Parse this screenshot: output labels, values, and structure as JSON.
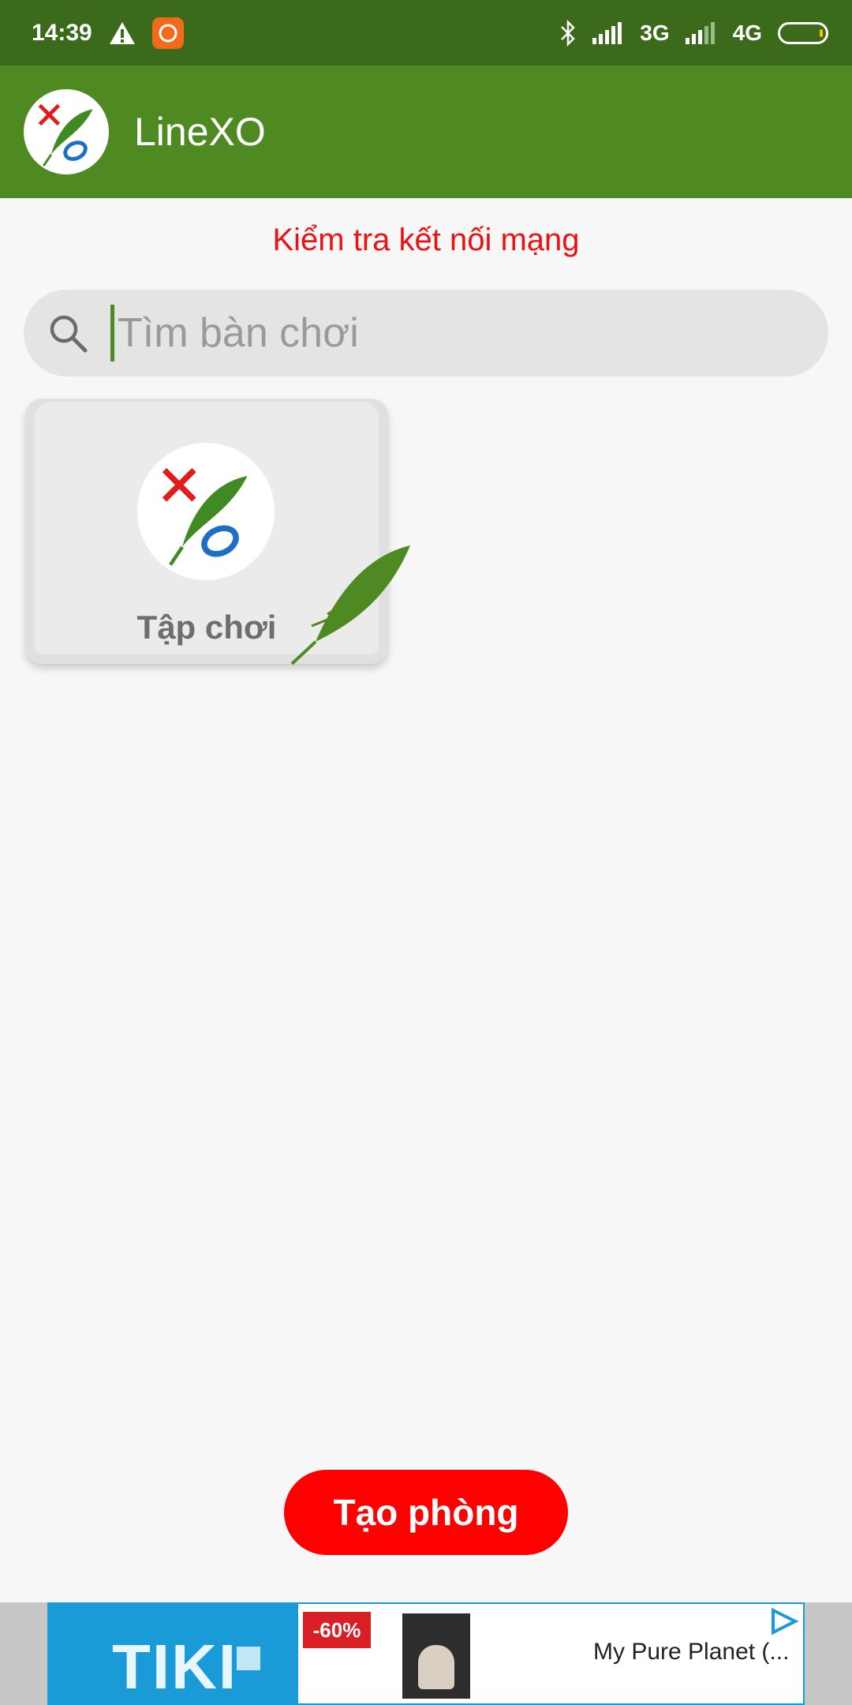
{
  "status_bar": {
    "time": "14:39",
    "network_3g": "3G",
    "network_4g": "4G",
    "icons": [
      "warning-icon",
      "mi-icon",
      "bluetooth-icon",
      "signal-icon",
      "battery-icon"
    ]
  },
  "app_bar": {
    "title": "LineXO",
    "logo_icon": "xo-feather-logo"
  },
  "main": {
    "network_message": "Kiểm tra kết nối mạng",
    "search": {
      "placeholder": "Tìm bàn chơi",
      "value": ""
    },
    "rooms": [
      {
        "label": "Tập chơi",
        "icon": "xo-feather-logo"
      }
    ],
    "create_button": "Tạo phòng"
  },
  "ad": {
    "brand": "TIKI",
    "discount": "-60%",
    "text": "My Pure Planet (...",
    "colors": {
      "brand": "#1a9bd7",
      "discount": "#d81f26"
    }
  },
  "colors": {
    "status_bar": "#3b6a1b",
    "app_bar": "#4e8a21",
    "accent_red": "#ff0000",
    "message_red": "#ee1111"
  }
}
